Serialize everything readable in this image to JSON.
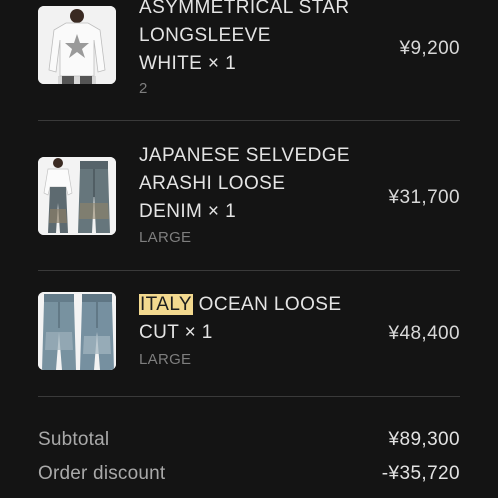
{
  "items": [
    {
      "name_lines": [
        "ASYMMETRICAL STAR",
        "LONGSLEEVE"
      ],
      "name_last": "WHITE",
      "quantity": "× 1",
      "variant": "2",
      "price": "¥9,200",
      "image_icon": "white-longsleeve-product-image"
    },
    {
      "name_lines": [
        "JAPANESE SELVEDGE",
        "ARASHI LOOSE"
      ],
      "name_last": "DENIM",
      "quantity": "× 1",
      "variant": "LARGE",
      "price": "¥31,700",
      "image_icon": "denim-outfit-product-image"
    },
    {
      "name_highlight": "ITALY",
      "name_rest": "OCEAN LOOSE",
      "name_last": "CUT",
      "quantity": "× 1",
      "variant": "LARGE",
      "price": "¥48,400",
      "image_icon": "loose-jeans-product-image"
    }
  ],
  "summary": {
    "subtotal_label": "Subtotal",
    "subtotal_value": "¥89,300",
    "discount_label": "Order discount",
    "discount_value": "-¥35,720"
  },
  "colors": {
    "background": "#141414",
    "highlight": "#f3d98f",
    "divider": "#3a3a3a"
  }
}
